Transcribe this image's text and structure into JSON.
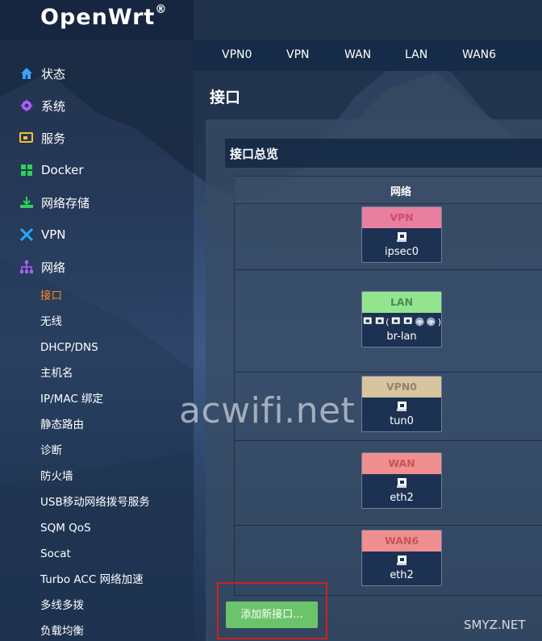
{
  "brand": {
    "name": "OpenWrt",
    "reg": "®"
  },
  "sidebar": {
    "items": [
      {
        "label": "状态",
        "icon": "home-icon"
      },
      {
        "label": "系统",
        "icon": "gear-icon"
      },
      {
        "label": "服务",
        "icon": "services-icon"
      },
      {
        "label": "Docker",
        "icon": "docker-icon"
      },
      {
        "label": "网络存储",
        "icon": "storage-icon"
      },
      {
        "label": "VPN",
        "icon": "vpn-icon"
      },
      {
        "label": "网络",
        "icon": "network-icon"
      }
    ],
    "network_sub": [
      "接口",
      "无线",
      "DHCP/DNS",
      "主机名",
      "IP/MAC 绑定",
      "静态路由",
      "诊断",
      "防火墙",
      "USB移动网络拨号服务",
      "SQM QoS",
      "Socat",
      "Turbo ACC 网络加速",
      "多线多拨",
      "负载均衡"
    ]
  },
  "topnav": [
    "VPN0",
    "VPN",
    "WAN",
    "LAN",
    "WAN6"
  ],
  "page": {
    "title": "接口",
    "section_title": "接口总览",
    "column_network": "网络"
  },
  "interfaces": [
    {
      "name": "VPN",
      "device": "ipsec0",
      "color": "#e87fa0"
    },
    {
      "name": "LAN",
      "device": "br-lan",
      "color": "#92e58e"
    },
    {
      "name": "VPN0",
      "device": "tun0",
      "color": "#d8c49e"
    },
    {
      "name": "WAN",
      "device": "eth2",
      "color": "#ef8f90"
    },
    {
      "name": "WAN6",
      "device": "eth2",
      "color": "#ef8f90"
    }
  ],
  "add_button": "添加新接口...",
  "watermark": "acwifi.net",
  "corner_mark": "SMYZ.NET"
}
